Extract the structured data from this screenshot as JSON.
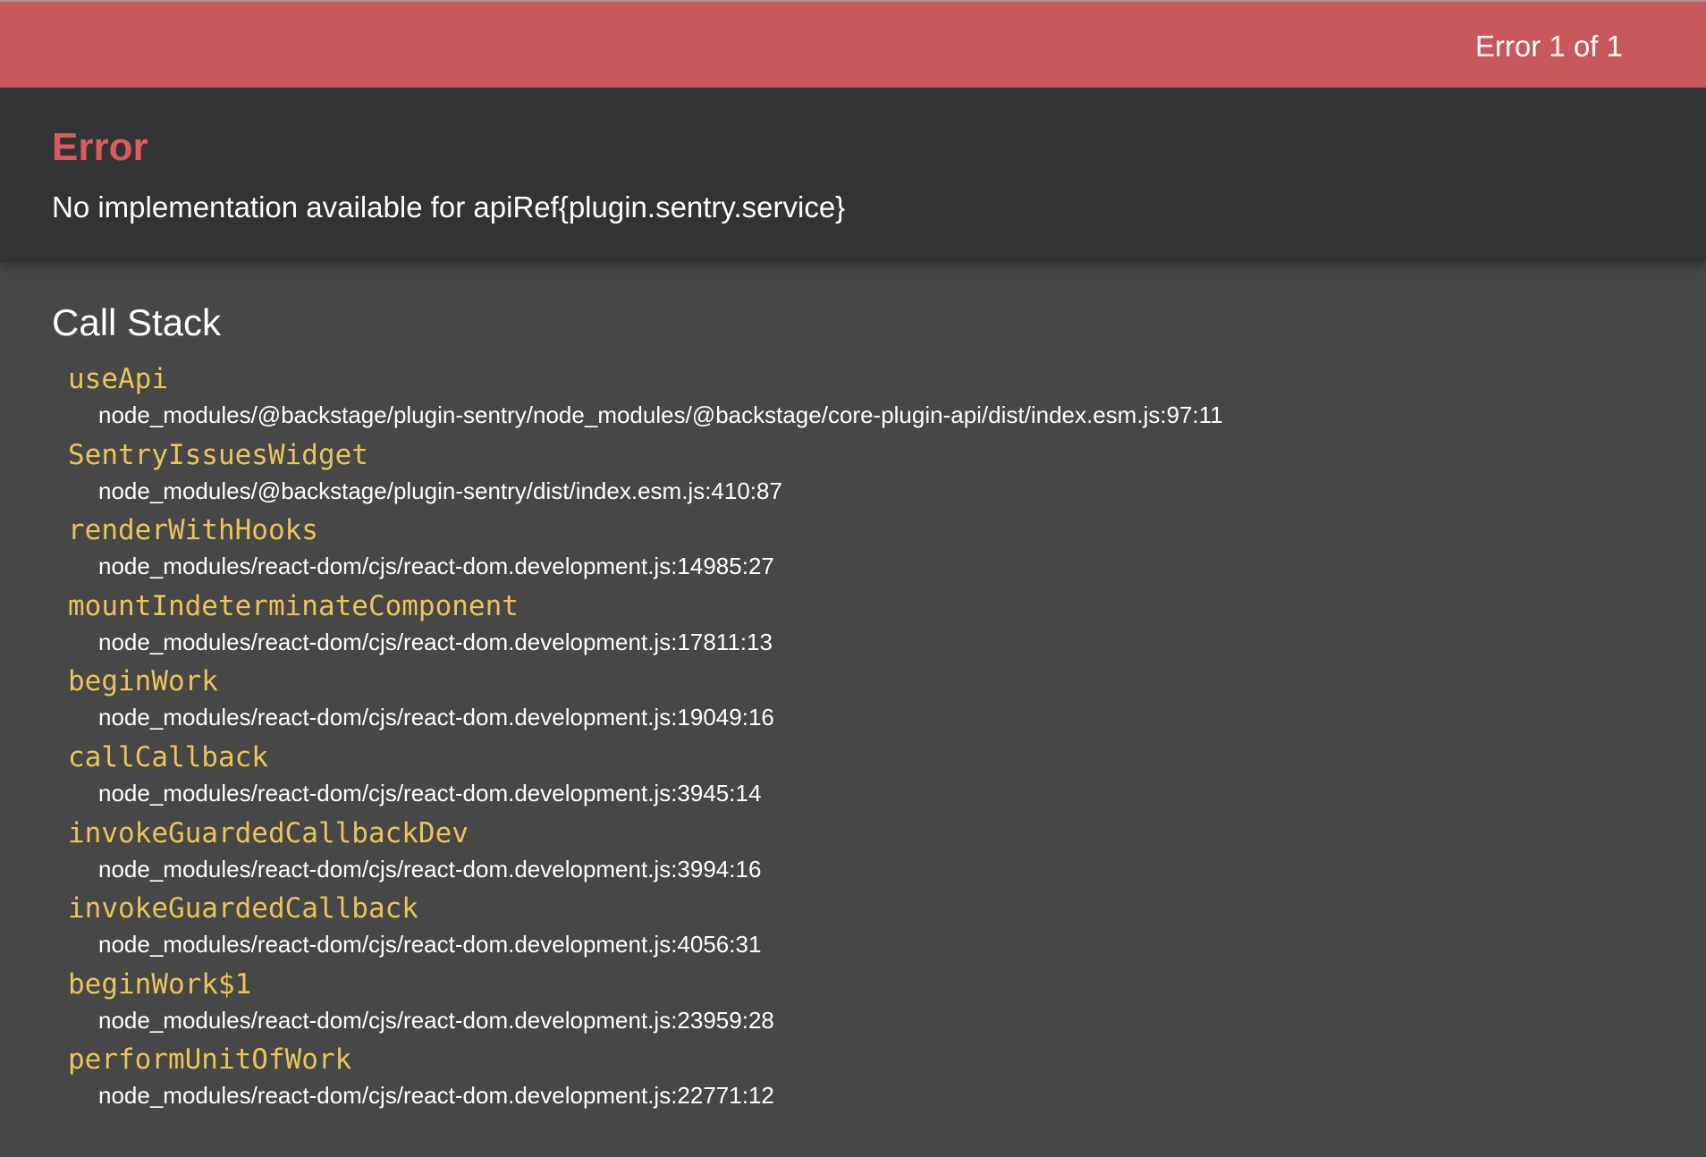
{
  "header": {
    "counter": "Error 1 of 1"
  },
  "error": {
    "title": "Error",
    "message": "No implementation available for apiRef{plugin.sentry.service}"
  },
  "call_stack": {
    "title": "Call Stack",
    "frames": [
      {
        "name": "useApi",
        "location": "node_modules/@backstage/plugin-sentry/node_modules/@backstage/core-plugin-api/dist/index.esm.js:97:11"
      },
      {
        "name": "SentryIssuesWidget",
        "location": "node_modules/@backstage/plugin-sentry/dist/index.esm.js:410:87"
      },
      {
        "name": "renderWithHooks",
        "location": "node_modules/react-dom/cjs/react-dom.development.js:14985:27"
      },
      {
        "name": "mountIndeterminateComponent",
        "location": "node_modules/react-dom/cjs/react-dom.development.js:17811:13"
      },
      {
        "name": "beginWork",
        "location": "node_modules/react-dom/cjs/react-dom.development.js:19049:16"
      },
      {
        "name": "callCallback",
        "location": "node_modules/react-dom/cjs/react-dom.development.js:3945:14"
      },
      {
        "name": "invokeGuardedCallbackDev",
        "location": "node_modules/react-dom/cjs/react-dom.development.js:3994:16"
      },
      {
        "name": "invokeGuardedCallback",
        "location": "node_modules/react-dom/cjs/react-dom.development.js:4056:31"
      },
      {
        "name": "beginWork$1",
        "location": "node_modules/react-dom/cjs/react-dom.development.js:23959:28"
      },
      {
        "name": "performUnitOfWork",
        "location": "node_modules/react-dom/cjs/react-dom.development.js:22771:12"
      }
    ]
  },
  "colors": {
    "top_bar": "#c8585c",
    "header_bg": "#333333",
    "body_bg": "#474747",
    "error_title": "#d65c5f",
    "frame_name": "#e8c45b",
    "text": "#ffffff"
  }
}
